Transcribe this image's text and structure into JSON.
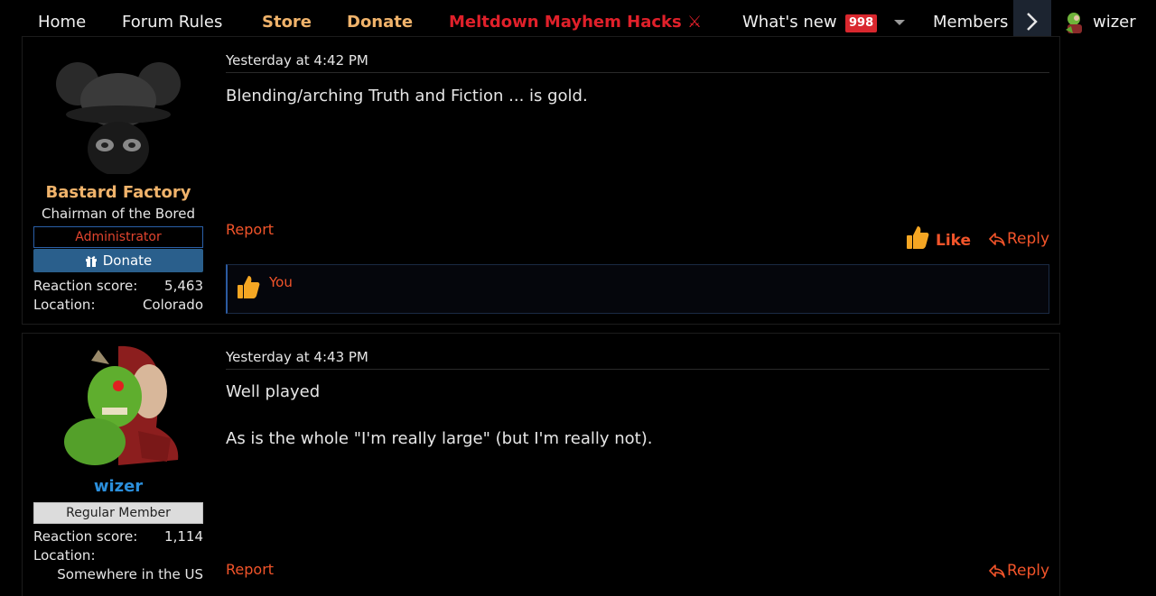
{
  "nav": {
    "home": "Home",
    "forum_rules": "Forum Rules",
    "store": "Store",
    "donate": "Donate",
    "meltdown": "Meltdown Mayhem Hacks ⚔",
    "whats_new": "What's new",
    "whats_new_count": "998",
    "members": "Members",
    "user": "wizer",
    "colors": {
      "gold": "#f0b36b",
      "red": "#e0202a",
      "badge": "#d9272e"
    }
  },
  "posts": [
    {
      "author": {
        "name": "Bastard Factory",
        "title": "Chairman of the Bored",
        "banner": "Administrator",
        "donate_label": "Donate",
        "reaction_score_label": "Reaction score:",
        "reaction_score": "5,463",
        "location_label": "Location:",
        "location": "Colorado",
        "avatar_icon": "mouse-ears-hat-mask-avatar"
      },
      "time": "Yesterday at 4:42 PM",
      "body": [
        "Blending/arching Truth and Fiction ... is gold."
      ],
      "report": "Report",
      "like": "Like",
      "reply": "Reply",
      "reactions": {
        "icon": "thumbs-up-icon",
        "who": "You"
      }
    },
    {
      "author": {
        "name": "wizer",
        "banner": "Regular Member",
        "reaction_score_label": "Reaction score:",
        "reaction_score": "1,114",
        "location_label": "Location:",
        "location": "Somewhere in the US",
        "avatar_icon": "green-troll-avatar"
      },
      "time": "Yesterday at 4:43 PM",
      "body": [
        "Well played",
        "As is the whole \"I'm really large\" (but I'm really not)."
      ],
      "report": "Report",
      "reply": "Reply"
    }
  ],
  "colors": {
    "accent": "#f2542a",
    "admin_border": "#2a5fa8",
    "donate_bg": "#2a5f8c",
    "member_name": "#2b8fdc"
  }
}
